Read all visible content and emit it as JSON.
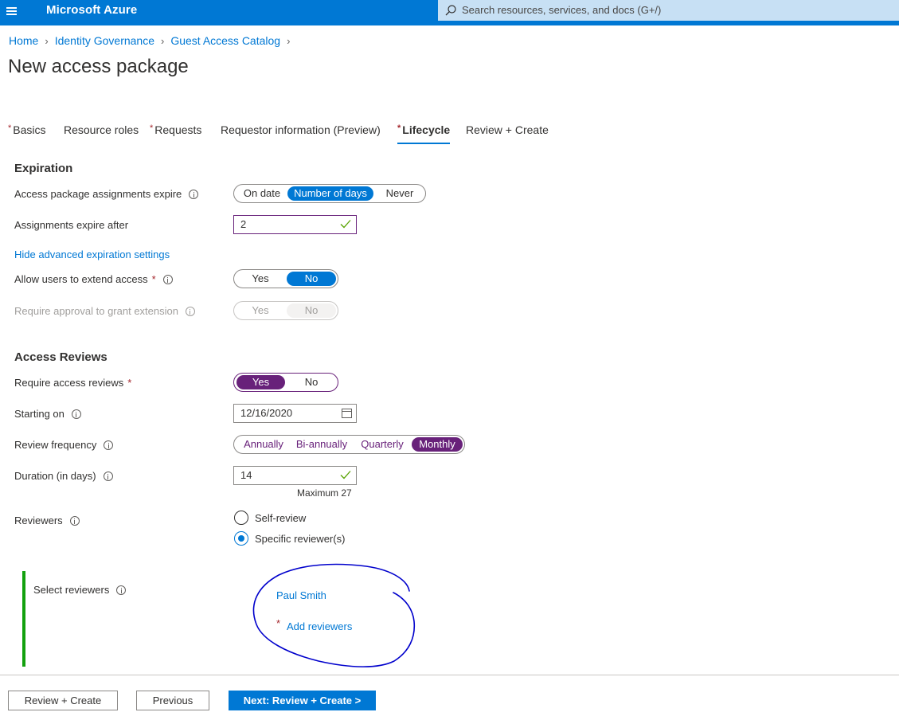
{
  "topbar": {
    "menu_icon": "hamburger-menu-icon",
    "brand": "Microsoft Azure",
    "search_icon": "search-icon",
    "search_placeholder": "Search resources, services, and docs (G+/)"
  },
  "breadcrumb": {
    "items": [
      "Home",
      "Identity Governance",
      "Guest Access Catalog"
    ],
    "separator_icon": "chevron-right-icon"
  },
  "page": {
    "title": "New access package"
  },
  "tabs": [
    {
      "label": "Basics",
      "required": true
    },
    {
      "label": "Resource roles",
      "required": false
    },
    {
      "label": "Requests",
      "required": true
    },
    {
      "label": "Requestor information (Preview)",
      "required": false
    },
    {
      "label": "Lifecycle",
      "required": true,
      "active": true
    },
    {
      "label": "Review + Create",
      "required": false
    }
  ],
  "expiration": {
    "section_title": "Expiration",
    "expire_label": "Access package assignments expire",
    "expire_options": [
      "On date",
      "Number of days",
      "Never"
    ],
    "expire_selected": "Number of days",
    "after_label": "Assignments expire after",
    "after_value": "2",
    "advanced_link": "Hide advanced expiration settings",
    "extend_label": "Allow users to extend access",
    "extend_options": [
      "Yes",
      "No"
    ],
    "extend_selected": "No",
    "approval_label": "Require approval to grant extension",
    "approval_options": [
      "Yes",
      "No"
    ],
    "approval_selected": "No",
    "approval_disabled": true
  },
  "access_reviews": {
    "section_title": "Access Reviews",
    "require_label": "Require access reviews",
    "require_options": [
      "Yes",
      "No"
    ],
    "require_selected": "Yes",
    "starting_label": "Starting on",
    "starting_value": "12/16/2020",
    "frequency_label": "Review frequency",
    "frequency_options": [
      "Annually",
      "Bi-annually",
      "Quarterly",
      "Monthly"
    ],
    "frequency_selected": "Monthly",
    "duration_label": "Duration (in days)",
    "duration_value": "14",
    "duration_max": "Maximum 27",
    "reviewers_label": "Reviewers",
    "reviewer_options": [
      "Self-review",
      "Specific reviewer(s)"
    ],
    "reviewer_selected": "Specific reviewer(s)",
    "select_reviewers_label": "Select reviewers",
    "reviewer_name": "Paul Smith",
    "add_reviewers_link": "Add reviewers"
  },
  "footer": {
    "review_create": "Review + Create",
    "previous": "Previous",
    "next": "Next: Review + Create >"
  },
  "colors": {
    "azure_blue": "#0078d4",
    "search_bg": "#c7e0f4",
    "purple": "#68217a",
    "required_red": "#a4262c",
    "green_bar": "#13a10e",
    "annotation_ink": "#0000cc"
  }
}
